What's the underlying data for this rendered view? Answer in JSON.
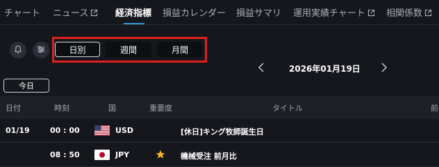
{
  "tabs": [
    {
      "label": "チャート",
      "external": false
    },
    {
      "label": "ニュース",
      "external": true
    },
    {
      "label": "経済指標",
      "external": false,
      "active": true
    },
    {
      "label": "損益カレンダー",
      "external": false
    },
    {
      "label": "損益サマリ",
      "external": false
    },
    {
      "label": "運用実績チャート",
      "external": true
    },
    {
      "label": "相関係数",
      "external": true
    }
  ],
  "controls": {
    "alert_icon": "bell-icon",
    "filter_icon": "sliders-icon",
    "period": {
      "options": [
        "日別",
        "週間",
        "月間"
      ],
      "selected": "日別"
    }
  },
  "date_nav": {
    "date": "2026年01月19日",
    "prev_icon": "chevron-left-icon",
    "next_icon": "chevron-right-icon"
  },
  "today_label": "今日",
  "table": {
    "columns": [
      "日付",
      "時刻",
      "国",
      "重要度",
      "タイトル",
      "前"
    ],
    "rows": [
      {
        "date": "01/19",
        "time": "00 : 00",
        "flag": "us-flag",
        "country": "USD",
        "importance": 0,
        "title": "[休日]キング牧師誕生日"
      },
      {
        "date": "",
        "time": "08 : 50",
        "flag": "jp-flag",
        "country": "JPY",
        "importance": 1,
        "title": "機械受注 前月比"
      }
    ]
  },
  "colors": {
    "background": "#15171c",
    "accent": "#2f9bd6",
    "highlight_border": "#e0201e",
    "star": "#f0b91a"
  }
}
